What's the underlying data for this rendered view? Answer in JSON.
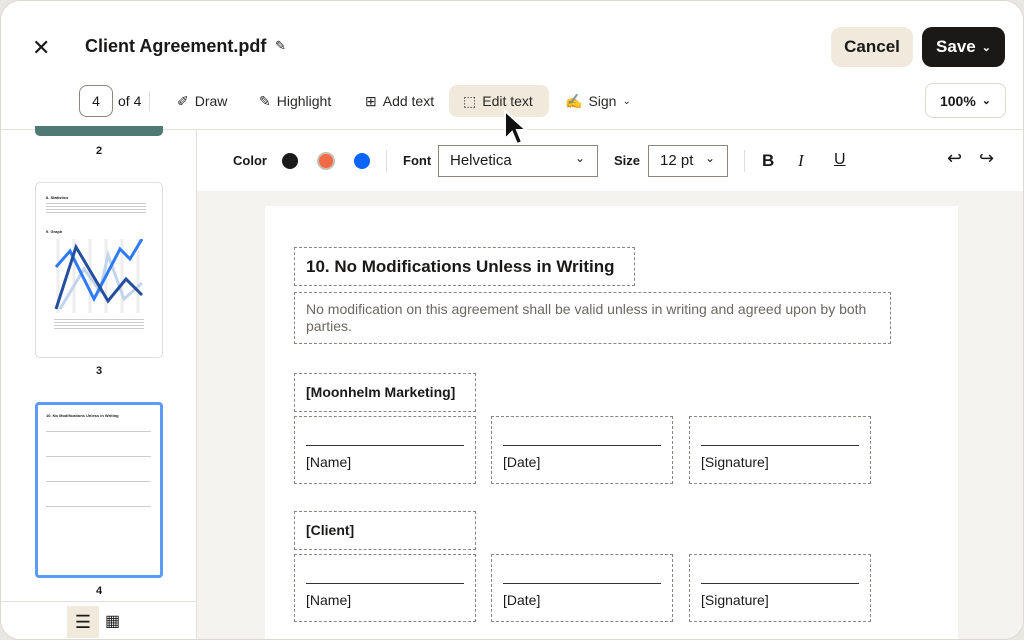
{
  "header": {
    "title": "Client Agreement.pdf",
    "cancel": "Cancel",
    "save": "Save"
  },
  "toolbar": {
    "page_current": "4",
    "page_of": "of 4",
    "draw": "Draw",
    "highlight": "Highlight",
    "add_text": "Add text",
    "edit_text": "Edit text",
    "sign": "Sign",
    "zoom": "100%"
  },
  "format": {
    "color_label": "Color",
    "colors": [
      "#1a1a1a",
      "#f26b47",
      "#0a64ff"
    ],
    "font_label": "Font",
    "font": "Helvetica",
    "size_label": "Size",
    "size": "12 pt",
    "bold": "B",
    "italic": "I",
    "underline": "U"
  },
  "sidebar": {
    "pages": [
      "2",
      "3",
      "4"
    ],
    "thumb3": {
      "heading1": "8. Statistics",
      "heading2": "9. Graph"
    },
    "thumb4": {
      "heading": "10. No Modifications Unless in Writing"
    }
  },
  "document": {
    "heading": "10. No Modifications Unless in Writing",
    "body": "No modification on this agreement shall be valid unless in writing and agreed upon by both parties.",
    "party1": "[Moonhelm Marketing]",
    "party2": "[Client]",
    "name": "[Name]",
    "date": "[Date]",
    "signature": "[Signature]"
  },
  "accent": "#5b9cf8"
}
